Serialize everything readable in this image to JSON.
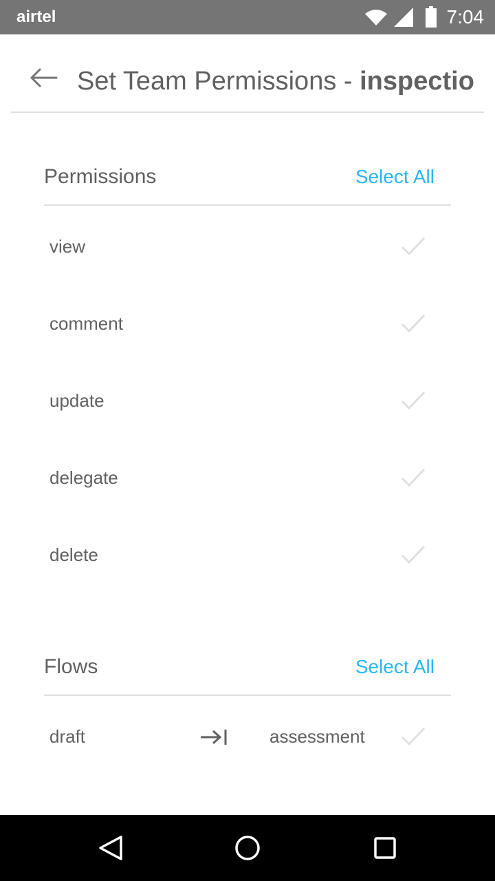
{
  "status_bar": {
    "carrier": "airtel",
    "time": "7:04",
    "icons": [
      "wifi-icon",
      "cell-signal-icon",
      "battery-icon"
    ]
  },
  "app_bar": {
    "back_icon": "arrow-back-icon",
    "title_prefix": "Set Team Permissions - ",
    "title_emphasis": "inspectio"
  },
  "permissions": {
    "title": "Permissions",
    "select_all": "Select All",
    "items": [
      {
        "label": "view",
        "checked": false
      },
      {
        "label": "comment",
        "checked": false
      },
      {
        "label": "update",
        "checked": false
      },
      {
        "label": "delegate",
        "checked": false
      },
      {
        "label": "delete",
        "checked": false
      }
    ]
  },
  "flows": {
    "title": "Flows",
    "select_all": "Select All",
    "items": [
      {
        "from": "draft",
        "arrow_icon": "arrow-to-end-icon",
        "to": "assessment",
        "checked": false
      }
    ]
  },
  "nav_bar": {
    "icons": [
      "back-triangle-icon",
      "home-circle-icon",
      "recents-square-icon"
    ]
  },
  "colors": {
    "status_bar": "#757575",
    "accent": "#29b6f6",
    "text": "#616161",
    "check_unchecked": "#e0e0e0",
    "divider": "#e0e0e0",
    "nav_bar": "#000000"
  }
}
